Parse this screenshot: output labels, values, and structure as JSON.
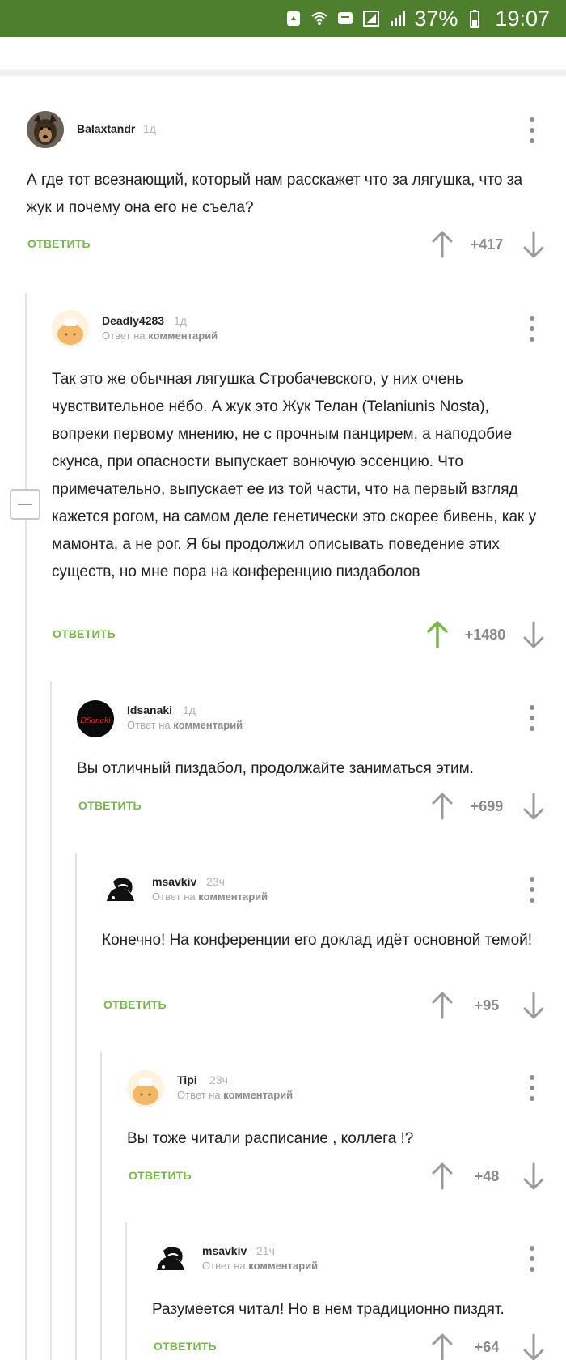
{
  "status_bar": {
    "battery_percent": "37%",
    "time": "19:07"
  },
  "comments": [
    {
      "username": "Balaxtandr",
      "time": "1д",
      "reply_to_prefix": "",
      "reply_to_link": "",
      "text": "А где тот всезнающий, который нам расскажет что за лягушка, что за жук и почему она его не съела?",
      "reply_label": "ОТВЕТИТЬ",
      "score": "+417",
      "upvoted": false,
      "avatar": "dog-avatar"
    },
    {
      "username": "Deadly4283",
      "time": "1д",
      "reply_to_prefix": "Ответ на",
      "reply_to_link": "комментарий",
      "text": "Так это же обычная лягушка Стробачевского, у них очень чувствительное нёбо. А жук это Жук Телан (Telaniunis Nosta), вопреки первому мнению, не с прочным панцирем, а наподобие скунса, при опасности выпускает вонючую эссенцию. Что примечательно, выпускает ее из той части, что на первый взгляд кажется рогом, на самом деле генетически это скорее бивень, как у мамонта, а не рог. Я бы продолжил описывать поведение этих существ, но мне пора на конференцию пиздаболов",
      "reply_label": "ОТВЕТИТЬ",
      "score": "+1480",
      "upvoted": true,
      "avatar": "default-avatar"
    },
    {
      "username": "Idsanaki",
      "time": "1д",
      "reply_to_prefix": "Ответ на",
      "reply_to_link": "комментарий",
      "text": "Вы отличный пиздабол, продолжайте заниматься этим.",
      "reply_label": "ОТВЕТИТЬ",
      "score": "+699",
      "upvoted": false,
      "avatar": "dsanaki-avatar"
    },
    {
      "username": "msavkiv",
      "time": "23ч",
      "reply_to_prefix": "Ответ на",
      "reply_to_link": "комментарий",
      "text": "Конечно! На конференции его доклад идёт основной темой!",
      "reply_label": "ОТВЕТИТЬ",
      "score": "+95",
      "upvoted": false,
      "avatar": "skunk-avatar"
    },
    {
      "username": "Tipi",
      "time": "23ч",
      "reply_to_prefix": "Ответ на",
      "reply_to_link": "комментарий",
      "text": "Вы тоже читали расписание , коллега !?",
      "reply_label": "ОТВЕТИТЬ",
      "score": "+48",
      "upvoted": false,
      "avatar": "default-avatar"
    },
    {
      "username": "msavkiv",
      "time": "21ч",
      "reply_to_prefix": "Ответ на",
      "reply_to_link": "комментарий",
      "text": "Разумеется читал! Но в нем традиционно пиздят.",
      "reply_label": "ОТВЕТИТЬ",
      "score": "+64",
      "upvoted": false,
      "avatar": "skunk-avatar"
    }
  ],
  "colors": {
    "status_bar": "#4d7f2d",
    "accent_green": "#77b84a",
    "muted": "#8a8a8a"
  }
}
